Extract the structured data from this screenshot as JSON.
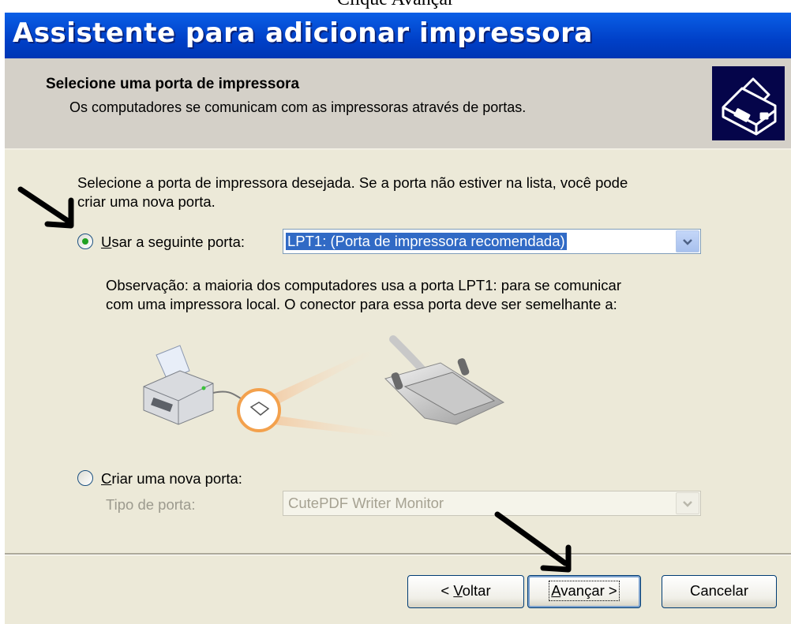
{
  "caption": "Clique Avançar",
  "window": {
    "title": "Assistente para adicionar impressora"
  },
  "header": {
    "title": "Selecione uma porta de impressora",
    "subtitle": "Os computadores se comunicam com as impressoras através de portas.",
    "icon": "printer-wizard-icon"
  },
  "body": {
    "instruction_line1": "Selecione a porta de impressora desejada. Se a porta não estiver na lista, você pode",
    "instruction_line2": "criar uma nova porta.",
    "use_port": {
      "label_accel": "U",
      "label_rest": "sar a seguinte porta:",
      "selected": true,
      "value": "LPT1: (Porta de impressora recomendada)"
    },
    "note_line1": "Observação: a maioria dos computadores usa a porta LPT1: para se comunicar",
    "note_line2": "com uma impressora local. O conector para essa porta deve ser semelhante a:",
    "illustration": "printer-parallel-connector-illustration",
    "new_port": {
      "label_accel": "C",
      "label_rest": "riar uma nova porta:",
      "selected": false,
      "type_label": "Tipo de porta:",
      "type_value": "CutePDF Writer Monitor"
    }
  },
  "buttons": {
    "back_prefix": "< ",
    "back_accel": "V",
    "back_rest": "oltar",
    "next_accel": "A",
    "next_rest": "vançar >",
    "cancel": "Cancelar"
  },
  "colors": {
    "title_bar": "#0040c8",
    "dialog_bg": "#ece9d8",
    "header_bg": "#d4d0c8",
    "selection": "#316ac5"
  }
}
